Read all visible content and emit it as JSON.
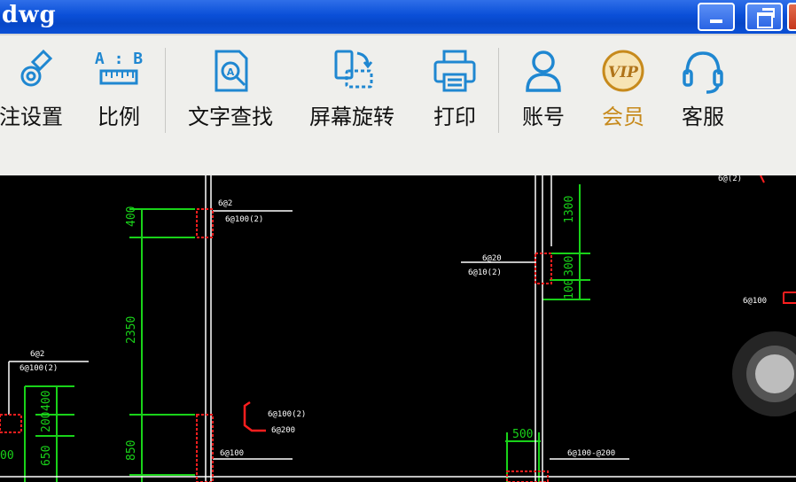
{
  "window": {
    "title": "dwg"
  },
  "toolbar": {
    "items": [
      {
        "id": "annotation-settings",
        "label": "注设置",
        "icon": "gear-pen-icon"
      },
      {
        "id": "scale",
        "label": "比例",
        "icon": "ruler-ab-icon"
      },
      {
        "id": "text-search",
        "label": "文字查找",
        "icon": "doc-search-icon"
      },
      {
        "id": "screen-rotate",
        "label": "屏幕旋转",
        "icon": "rotate-screen-icon"
      },
      {
        "id": "print",
        "label": "打印",
        "icon": "printer-icon"
      },
      {
        "id": "account",
        "label": "账号",
        "icon": "user-icon"
      },
      {
        "id": "vip",
        "label": "会员",
        "icon": "vip-badge-icon",
        "color": "#c78a1c"
      },
      {
        "id": "support",
        "label": "客服",
        "icon": "headset-icon"
      }
    ],
    "scale_icon_text": "A : B"
  },
  "drawing": {
    "dims": [
      "400",
      "2350",
      "850",
      "400",
      "200",
      "650",
      "1300",
      "300",
      "500"
    ],
    "extra_dims": [
      "100",
      "00"
    ],
    "labels": [
      "6@2",
      "6@100(2)",
      "6@10(2)",
      "6@100(2)",
      "6@100(2)",
      "6@200",
      "6@100(2)",
      "6@(2)",
      "6@20",
      "6@100",
      "6@100-@200"
    ],
    "colors": {
      "dim": "#19d219",
      "wall": "#ff1e1e",
      "line": "#ffffff"
    }
  }
}
